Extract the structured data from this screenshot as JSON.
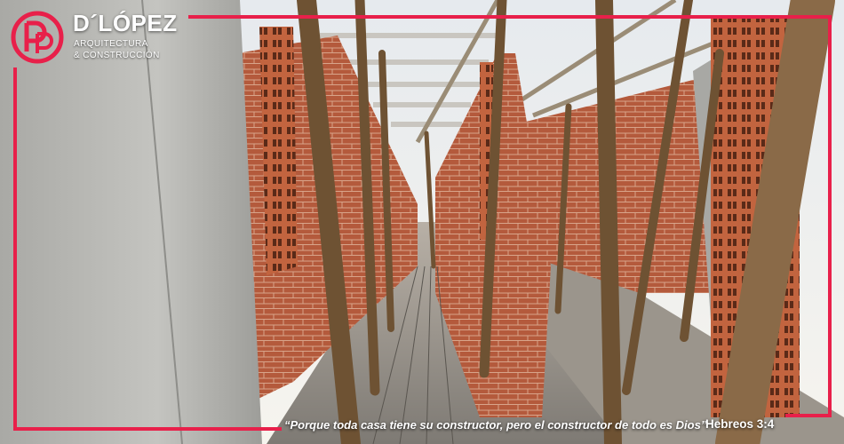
{
  "brand": {
    "name": "D´LÓPEZ",
    "tagline_line1": "ARQUITECTURA",
    "tagline_line2": "& CONSTRUCCIÓN",
    "logo_letters": "DLP",
    "accent_color": "#e8204a"
  },
  "caption": {
    "quote": "“Porque toda casa tiene su constructor, pero el constructor de todo es Dios”",
    "reference": "Hebreos 3:4"
  },
  "photo": {
    "colors": {
      "sky": "#e9edf1",
      "concrete": "#b8b8b4",
      "brick": "#b45a3c",
      "wood": "#7a5a3a",
      "floor": "#8d8a85"
    }
  }
}
